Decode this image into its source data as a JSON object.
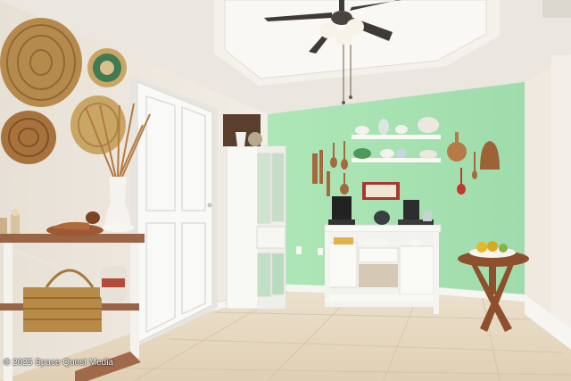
{
  "watermark": {
    "text": "© 2025 Space Quest Media"
  },
  "colors": {
    "wall_green": "#a9e3b3",
    "wall_cream": "#ece6dc",
    "ceiling": "#eeeae3",
    "floor_tile": "#e4d6bf",
    "white_trim": "#f7f7f4",
    "wood": "#a0694a",
    "wicker": "#b18545"
  },
  "icons": [
    "ceiling-fan-icon",
    "coffee-maker-icon",
    "kettle-icon"
  ]
}
